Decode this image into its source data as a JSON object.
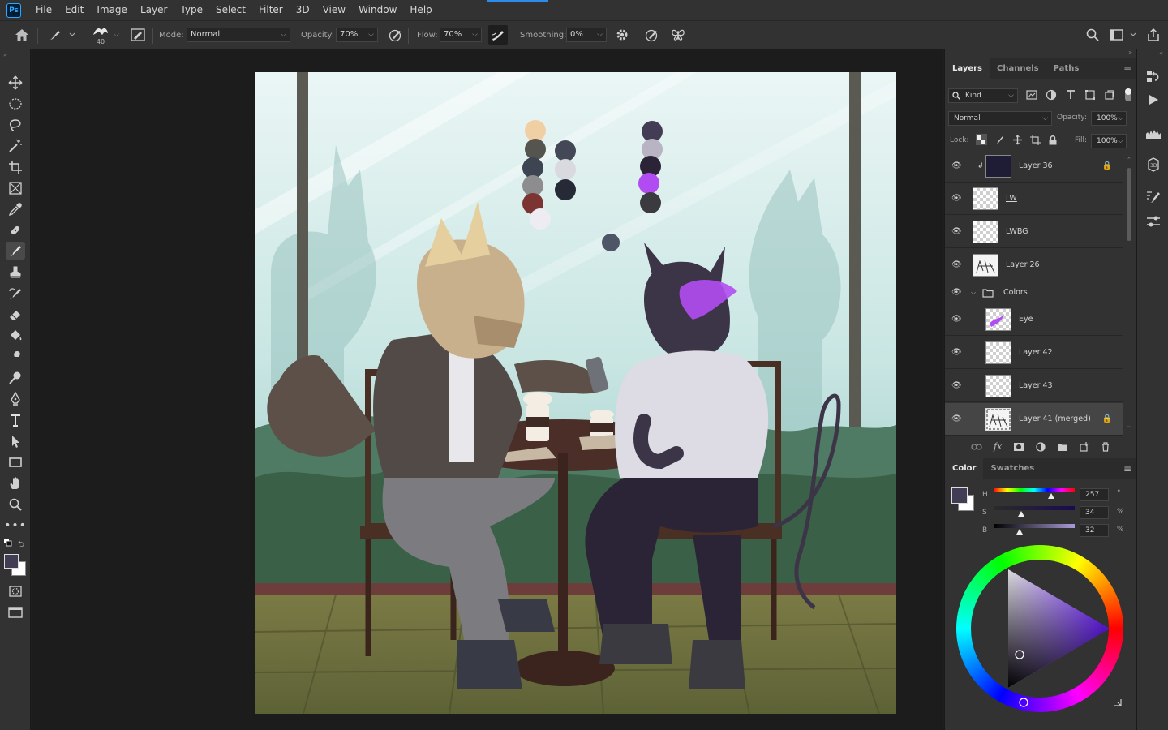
{
  "menu": {
    "logo": "Ps",
    "items": [
      "File",
      "Edit",
      "Image",
      "Layer",
      "Type",
      "Select",
      "Filter",
      "3D",
      "View",
      "Window",
      "Help"
    ]
  },
  "options": {
    "brush_size": "40",
    "mode_label": "Mode:",
    "mode_value": "Normal",
    "opacity_label": "Opacity:",
    "opacity_value": "70%",
    "flow_label": "Flow:",
    "flow_value": "70%",
    "smoothing_label": "Smoothing:",
    "smoothing_value": "0%"
  },
  "layers_panel": {
    "tabs": [
      "Layers",
      "Channels",
      "Paths"
    ],
    "filter_kind": "Kind",
    "blend_mode": "Normal",
    "opacity_label": "Opacity:",
    "opacity_value": "100%",
    "lock_label": "Lock:",
    "fill_label": "Fill:",
    "fill_value": "100%",
    "layers": [
      {
        "name": "Layer 36",
        "thumb": "navy",
        "locked": true,
        "clipped": true,
        "indent": 1
      },
      {
        "name": "LW",
        "thumb": "transparent",
        "locked": false,
        "underline": true,
        "indent": 0
      },
      {
        "name": "LWBG",
        "thumb": "transparent",
        "locked": false,
        "indent": 0
      },
      {
        "name": "Layer 26",
        "thumb": "sketch",
        "locked": false,
        "indent": 0
      },
      {
        "name": "Colors",
        "group": true,
        "indent": 0
      },
      {
        "name": "Eye",
        "thumb": "purple",
        "locked": false,
        "indent": 1
      },
      {
        "name": "Layer 42",
        "thumb": "transparent",
        "locked": false,
        "indent": 1
      },
      {
        "name": "Layer 43",
        "thumb": "transparent",
        "locked": false,
        "indent": 1
      },
      {
        "name": "Layer 41 (merged)",
        "thumb": "sketch",
        "locked": true,
        "selected": true,
        "indent": 1
      }
    ]
  },
  "color_panel": {
    "tabs": [
      "Color",
      "Swatches"
    ],
    "h_label": "H",
    "h_value": "257",
    "h_unit": "°",
    "s_label": "S",
    "s_value": "34",
    "s_unit": "%",
    "b_label": "B",
    "b_value": "32",
    "b_unit": "%",
    "foreground": "#433c55",
    "background": "#ffffff",
    "h": 257,
    "s": 34,
    "b": 32
  },
  "palette": {
    "foreground": "#433c55",
    "background": "#ffffff"
  }
}
